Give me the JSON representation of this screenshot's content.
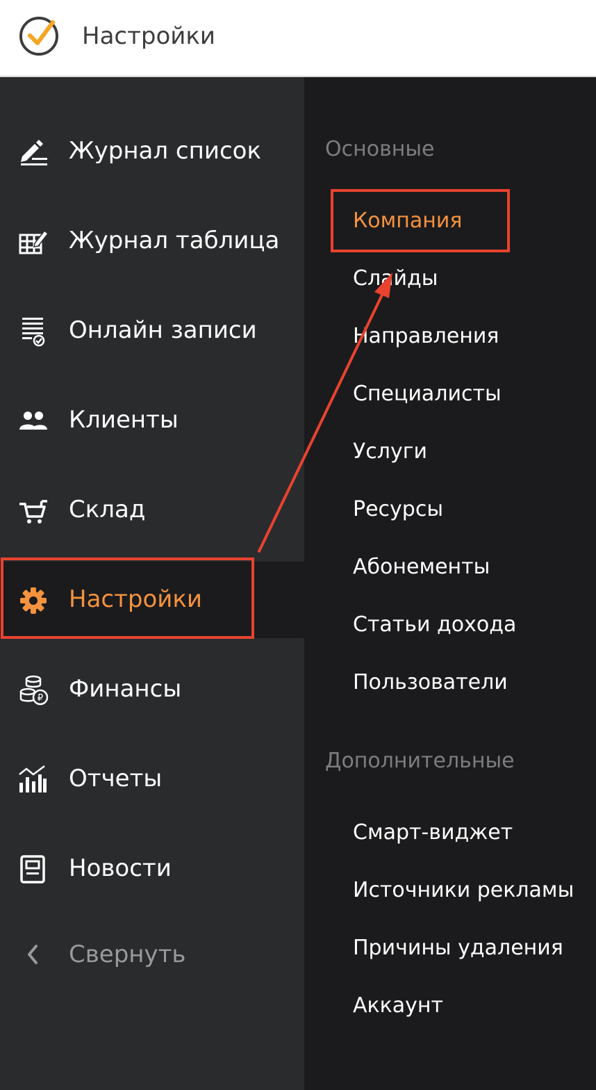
{
  "header": {
    "title": "Настройки",
    "logo_icon": "clock-check-logo"
  },
  "sidebar": {
    "items": [
      {
        "label": "Журнал список",
        "icon": "edit-list-icon"
      },
      {
        "label": "Журнал таблица",
        "icon": "edit-table-icon"
      },
      {
        "label": "Онлайн записи",
        "icon": "online-bookings-icon"
      },
      {
        "label": "Клиенты",
        "icon": "users-icon"
      },
      {
        "label": "Склад",
        "icon": "cart-icon"
      },
      {
        "label": "Настройки",
        "icon": "gear-icon",
        "active": true
      },
      {
        "label": "Финансы",
        "icon": "coins-icon"
      },
      {
        "label": "Отчеты",
        "icon": "chart-icon"
      },
      {
        "label": "Новости",
        "icon": "news-icon"
      },
      {
        "label": "Свернуть",
        "icon": "chevron-left-icon"
      }
    ]
  },
  "submenu": {
    "main_section": "Основные",
    "main_items": [
      {
        "label": "Компания",
        "active": true
      },
      {
        "label": "Слайды"
      },
      {
        "label": "Направления"
      },
      {
        "label": "Специалисты"
      },
      {
        "label": "Услуги"
      },
      {
        "label": "Ресурсы"
      },
      {
        "label": "Абонементы"
      },
      {
        "label": "Статьи дохода"
      },
      {
        "label": "Пользователи"
      }
    ],
    "extra_section": "Дополнительные",
    "extra_items": [
      {
        "label": "Смарт-виджет"
      },
      {
        "label": "Источники рекламы"
      },
      {
        "label": "Причины удаления"
      },
      {
        "label": "Аккаунт"
      }
    ]
  },
  "colors": {
    "accent": "#f5923e",
    "annotation": "#e8432f",
    "sidebar_bg": "#2a2b2d",
    "submenu_bg": "#1b1b1d"
  }
}
